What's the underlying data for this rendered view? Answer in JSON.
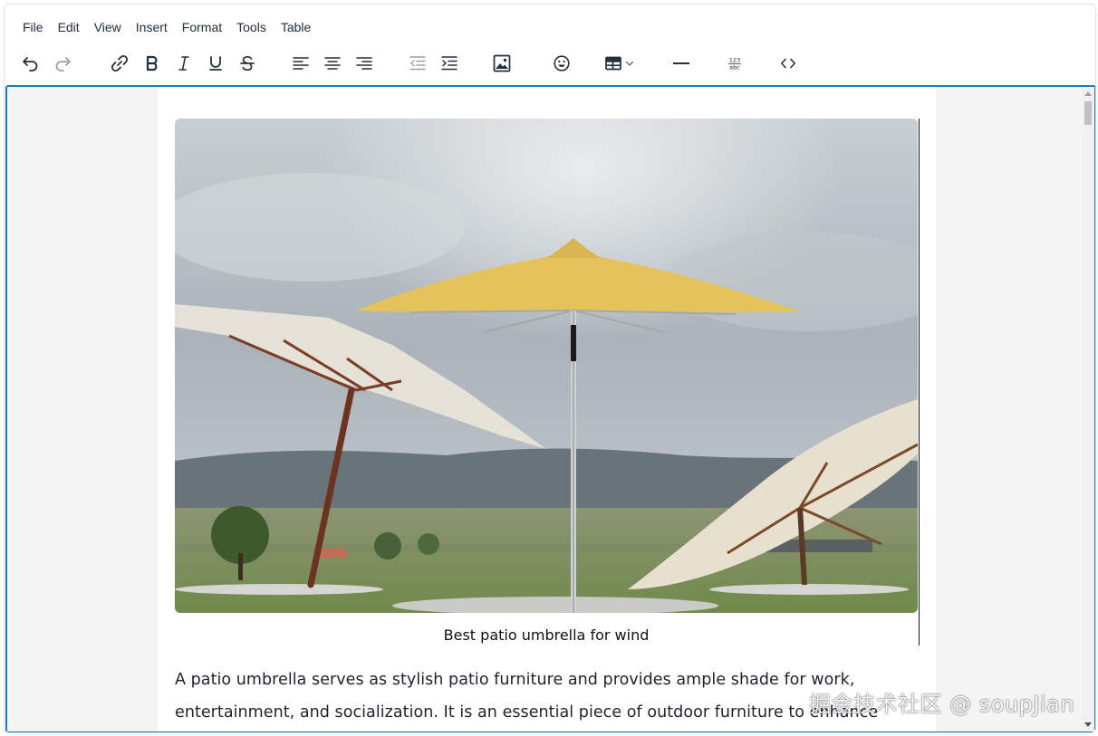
{
  "menubar": {
    "items": [
      "File",
      "Edit",
      "View",
      "Insert",
      "Format",
      "Tools",
      "Table"
    ]
  },
  "toolbar": {
    "buttons": [
      {
        "name": "undo",
        "icon": "undo-icon"
      },
      {
        "name": "redo",
        "icon": "redo-icon",
        "disabled": true
      },
      {
        "name": "link",
        "icon": "link-icon"
      },
      {
        "name": "bold",
        "icon": "bold-icon"
      },
      {
        "name": "italic",
        "icon": "italic-icon"
      },
      {
        "name": "underline",
        "icon": "underline-icon"
      },
      {
        "name": "strikethrough",
        "icon": "strikethrough-icon"
      },
      {
        "name": "align-left",
        "icon": "align-left-icon"
      },
      {
        "name": "align-center",
        "icon": "align-center-icon"
      },
      {
        "name": "align-right",
        "icon": "align-right-icon"
      },
      {
        "name": "outdent",
        "icon": "outdent-icon"
      },
      {
        "name": "indent",
        "icon": "indent-icon"
      },
      {
        "name": "image",
        "icon": "image-icon"
      },
      {
        "name": "emoticons",
        "icon": "emoji-icon"
      },
      {
        "name": "table",
        "icon": "table-icon"
      },
      {
        "name": "horizontal-rule",
        "icon": "horizontal-rule-icon"
      },
      {
        "name": "character-count",
        "icon": "123-abc-icon"
      },
      {
        "name": "source-code",
        "icon": "code-icon"
      }
    ]
  },
  "content": {
    "figure": {
      "image_description_icon": "patio-umbrella-photo",
      "caption": "Best patio umbrella for wind"
    },
    "paragraph_line1": "A patio umbrella serves as stylish patio furniture and provides ample shade for work,",
    "paragraph_line2": "entertainment, and socialization. It is an essential piece of outdoor furniture to enhance the"
  },
  "watermark": "掘金技术社区 @ soupJian",
  "colors": {
    "accent_border": "#207ab7",
    "icon": "#222f3e",
    "frame_background": "#f4f4f4"
  }
}
